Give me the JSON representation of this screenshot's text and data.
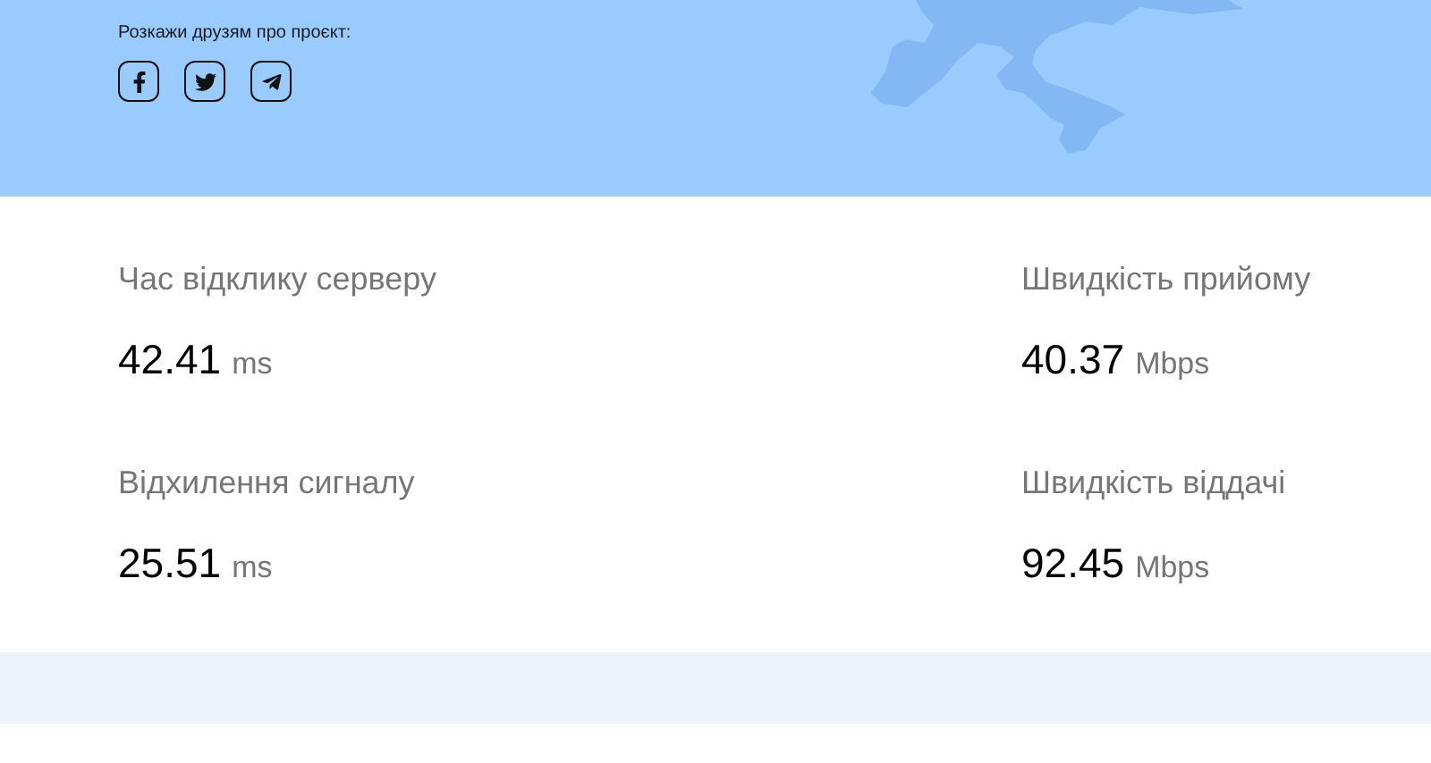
{
  "share": {
    "label": "Розкажи друзям про проєкт:",
    "links": [
      {
        "kind": "facebook"
      },
      {
        "kind": "twitter"
      },
      {
        "kind": "telegram"
      }
    ]
  },
  "metrics": [
    {
      "label": "Час відклику серверу",
      "value": "42.41",
      "unit": "ms"
    },
    {
      "label": "Швидкість прийому",
      "value": "40.37",
      "unit": "Mbps"
    },
    {
      "label": "Відхилення сигналу",
      "value": "25.51",
      "unit": "ms"
    },
    {
      "label": "Швидкість віддачі",
      "value": "92.45",
      "unit": "Mbps"
    }
  ]
}
